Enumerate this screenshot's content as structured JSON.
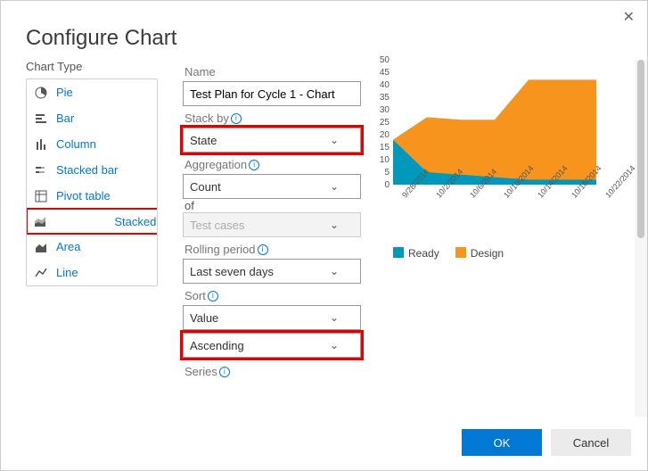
{
  "dialog": {
    "title": "Configure Chart",
    "close": "✕"
  },
  "sidebar": {
    "label": "Chart Type",
    "items": [
      {
        "label": "Pie",
        "icon": "pie-icon"
      },
      {
        "label": "Bar",
        "icon": "bar-icon"
      },
      {
        "label": "Column",
        "icon": "column-icon"
      },
      {
        "label": "Stacked bar",
        "icon": "stacked-bar-icon"
      },
      {
        "label": "Pivot table",
        "icon": "pivot-table-icon"
      },
      {
        "label": "Stacked area",
        "icon": "stacked-area-icon"
      },
      {
        "label": "Area",
        "icon": "area-icon"
      },
      {
        "label": "Line",
        "icon": "line-icon"
      }
    ],
    "selected_index": 5
  },
  "form": {
    "name_label": "Name",
    "name_value": "Test Plan for Cycle 1 - Chart",
    "stack_by_label": "Stack by",
    "stack_by_value": "State",
    "aggregation_label": "Aggregation",
    "aggregation_value": "Count",
    "of_label": "of",
    "of_value": "Test cases",
    "rolling_label": "Rolling period",
    "rolling_value": "Last seven days",
    "sort_label": "Sort",
    "sort_value1": "Value",
    "sort_value2": "Ascending",
    "series_label": "Series"
  },
  "buttons": {
    "ok": "OK",
    "cancel": "Cancel"
  },
  "legend": {
    "ready": "Ready",
    "design": "Design"
  },
  "colors": {
    "ready": "#0099bc",
    "design": "#f7941d",
    "accent": "#0078d4",
    "highlight": "#e60000"
  },
  "chart_data": {
    "type": "area",
    "stacked": true,
    "categories": [
      "9/28/2014",
      "10/2/2014",
      "10/6/2014",
      "10/10/2014",
      "10/14/2014",
      "10/18/2014",
      "10/22/2014"
    ],
    "series": [
      {
        "name": "Ready",
        "color": "#0099bc",
        "values": [
          18,
          5,
          4,
          3,
          2,
          2,
          2
        ]
      },
      {
        "name": "Design",
        "color": "#f7941d",
        "values": [
          0,
          22,
          22,
          23,
          40,
          40,
          40
        ]
      }
    ],
    "ylim": [
      0,
      50
    ],
    "yticks": [
      0,
      5,
      10,
      15,
      20,
      25,
      30,
      35,
      40,
      45,
      50
    ],
    "xlabel": "",
    "ylabel": "",
    "title": ""
  }
}
